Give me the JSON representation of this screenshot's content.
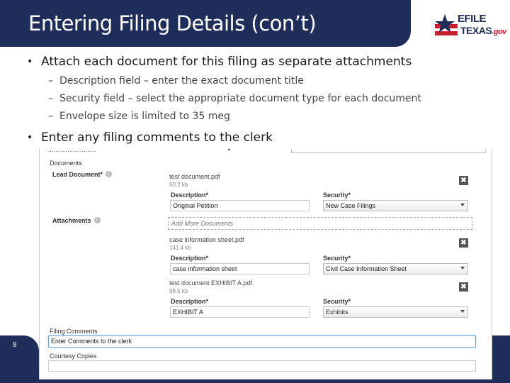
{
  "slide": {
    "title": "Entering Filing Details (con’t)",
    "page_number": "8"
  },
  "logo": {
    "line1": "EFILE",
    "line2": "TEXAS",
    "line2_suffix": ".gov",
    "colors": {
      "navy": "#1f2d5a",
      "red": "#c8202f"
    }
  },
  "bullets": {
    "first": "Attach each document for this filing as separate attachments",
    "subs": [
      "Description field – enter the exact document title",
      "Security field – select the appropriate document type for each document",
      "Envelope size is limited to 35 meg"
    ],
    "second": "Enter any filing comments to the clerk"
  },
  "form": {
    "documents_label": "Documents",
    "lead_label": "Lead Document*",
    "attachments_label": "Attachments",
    "add_more": "Add More Documents",
    "filing_comments_label": "Filing Comments",
    "filing_comments_value": "Enter Comments to the clerk",
    "courtesy_label": "Courtesy Copies",
    "lead": {
      "file": "test document.pdf",
      "size": "90.2 kb",
      "description_label": "Description*",
      "description": "Original Petition",
      "security_label": "Security*",
      "security": "New Case Filings"
    },
    "attachments": [
      {
        "file": "case information sheet.pdf",
        "size": "141.4 kb",
        "description_label": "Description*",
        "description": "case information sheet",
        "security_label": "Security*",
        "security": "Civil Case Information Sheet"
      },
      {
        "file": "test document EXHIBIT A.pdf",
        "size": "98.5 kb",
        "description_label": "Description*",
        "description": "EXHIBIT A",
        "security_label": "Security*",
        "security": "Exhibits"
      }
    ],
    "remove_symbol": "✖",
    "info_symbol": "i"
  }
}
